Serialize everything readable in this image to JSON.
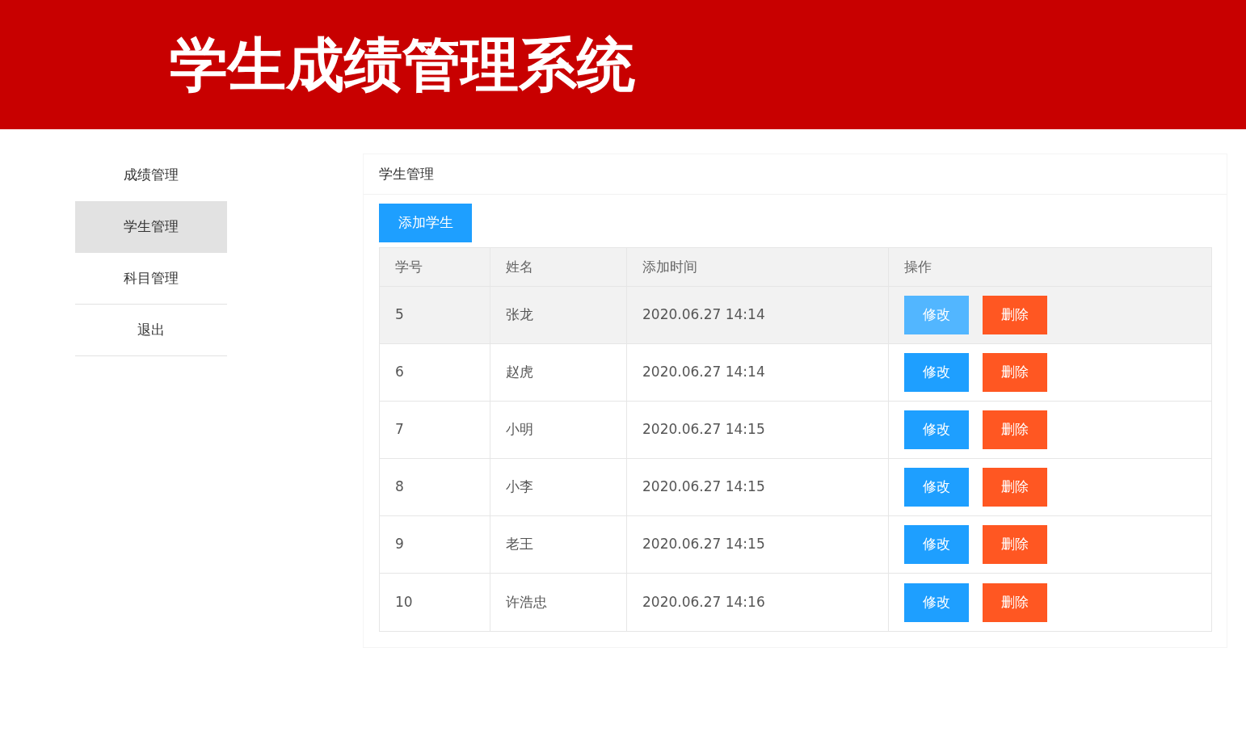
{
  "header": {
    "title": "学生成绩管理系统"
  },
  "sidebar": {
    "items": [
      {
        "label": "成绩管理",
        "selected": false
      },
      {
        "label": "学生管理",
        "selected": true
      },
      {
        "label": "科目管理",
        "selected": false
      },
      {
        "label": "退出",
        "selected": false
      }
    ]
  },
  "panel": {
    "title": "学生管理",
    "add_button": "添加学生"
  },
  "table": {
    "columns": [
      "学号",
      "姓名",
      "添加时间",
      "操作"
    ],
    "rows": [
      {
        "cells": [
          "5",
          "张龙",
          "2020.06.27 14:14"
        ],
        "highlighted": true,
        "actions": [
          "修改",
          "删除"
        ]
      },
      {
        "cells": [
          "6",
          "赵虎",
          "2020.06.27 14:14"
        ],
        "highlighted": false,
        "actions": [
          "修改",
          "删除"
        ]
      },
      {
        "cells": [
          "7",
          "小明",
          "2020.06.27 14:15"
        ],
        "highlighted": false,
        "actions": [
          "修改",
          "删除"
        ]
      },
      {
        "cells": [
          "8",
          "小李",
          "2020.06.27 14:15"
        ],
        "highlighted": false,
        "actions": [
          "修改",
          "删除"
        ]
      },
      {
        "cells": [
          "9",
          "老王",
          "2020.06.27 14:15"
        ],
        "highlighted": false,
        "actions": [
          "修改",
          "删除"
        ]
      },
      {
        "cells": [
          "10",
          "许浩忠",
          "2020.06.27 14:16"
        ],
        "highlighted": false,
        "actions": [
          "修改",
          "删除"
        ]
      }
    ]
  }
}
